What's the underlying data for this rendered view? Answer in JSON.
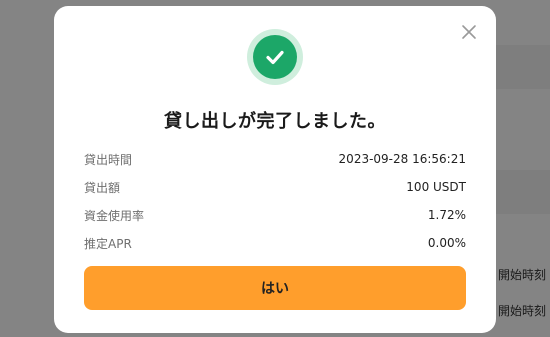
{
  "background": {
    "labels": [
      "開始時刻",
      "開始時刻"
    ]
  },
  "dialog": {
    "close_icon": "close-icon",
    "status_icon": "check-circle-icon",
    "title": "貸し出しが完了しました。",
    "rows": [
      {
        "label": "貸出時間",
        "value": "2023-09-28 16:56:21"
      },
      {
        "label": "貸出額",
        "value": "100 USDT"
      },
      {
        "label": "資金使用率",
        "value": "1.72%"
      },
      {
        "label": "推定APR",
        "value": "0.00%"
      }
    ],
    "confirm_label": "はい"
  },
  "colors": {
    "accent": "#ff9e2c",
    "success": "#1ca768",
    "success_light": "#cfeedd"
  }
}
